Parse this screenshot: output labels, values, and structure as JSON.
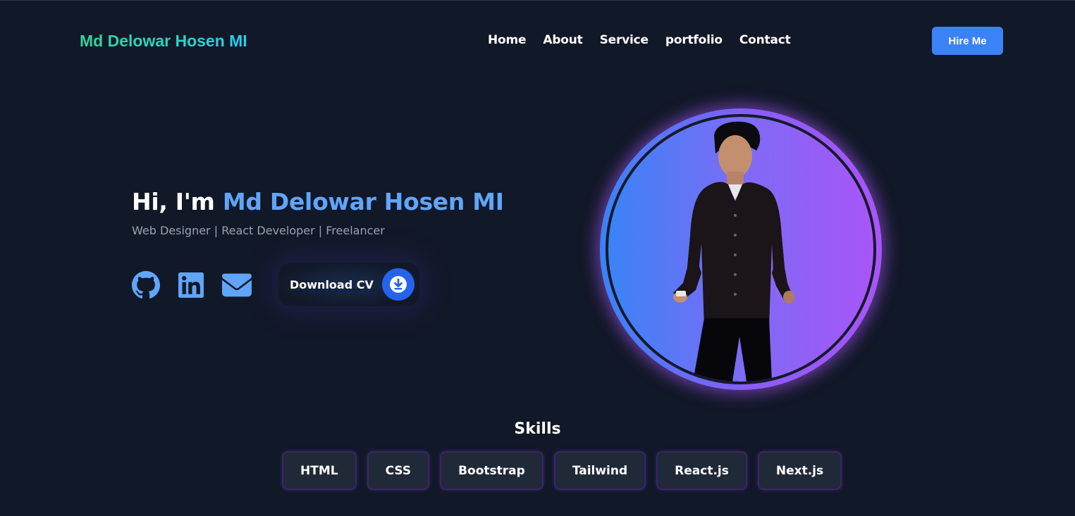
{
  "header": {
    "logo": "Md Delowar Hosen MI",
    "nav": [
      "Home",
      "About",
      "Service",
      "portfolio",
      "Contact"
    ],
    "hire_label": "Hire Me"
  },
  "hero": {
    "greeting": "Hi, I'm",
    "name": "Md Delowar Hosen MI",
    "subtitle": "Web Designer | React Developer | Freelancer",
    "socials": [
      {
        "icon": "github-icon"
      },
      {
        "icon": "linkedin-icon"
      },
      {
        "icon": "mail-icon"
      }
    ],
    "cv_label": "Download CV"
  },
  "skills": {
    "title": "Skills",
    "items": [
      "HTML",
      "CSS",
      "Bootstrap",
      "Tailwind",
      "React.js",
      "Next.js"
    ]
  },
  "colors": {
    "background": "#111827",
    "accent": "#3b82f6",
    "name_blue": "#60a5fa",
    "purple": "#a855f7",
    "logo_gradient": [
      "#34d399",
      "#22d3ee"
    ]
  }
}
